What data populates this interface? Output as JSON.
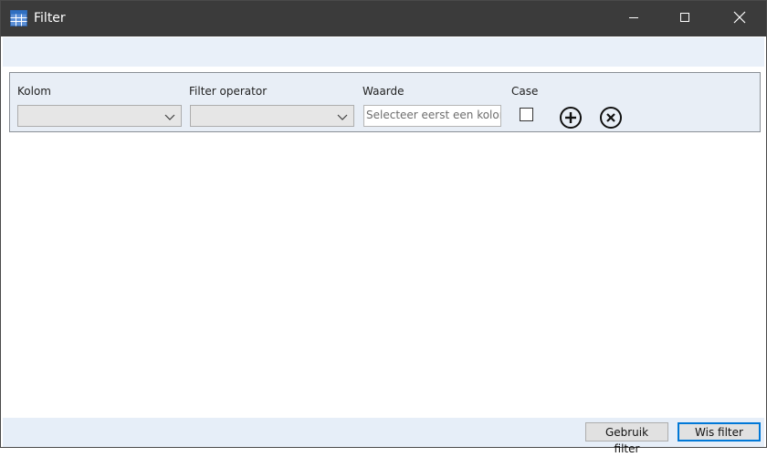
{
  "window": {
    "title": "Filter",
    "icon": "table-grid-icon",
    "controls": [
      "minimize-icon",
      "maximize-icon",
      "close-icon"
    ]
  },
  "filter_row": {
    "column_label": "Kolom",
    "column_value": "",
    "operator_label": "Filter operator",
    "operator_value": "",
    "value_label": "Waarde",
    "value_placeholder": "Selecteer eerst een kolom",
    "case_label": "Case",
    "case_checked": false,
    "add_icon": "plus-circle-icon",
    "remove_icon": "x-circle-icon"
  },
  "footer": {
    "apply_label": "Gebruik filter",
    "clear_label": "Wis filter"
  },
  "colors": {
    "titlebar": "#3b3b3b",
    "panel": "#e8eef6",
    "band": "#e9f0f9",
    "accent": "#0078d7"
  }
}
